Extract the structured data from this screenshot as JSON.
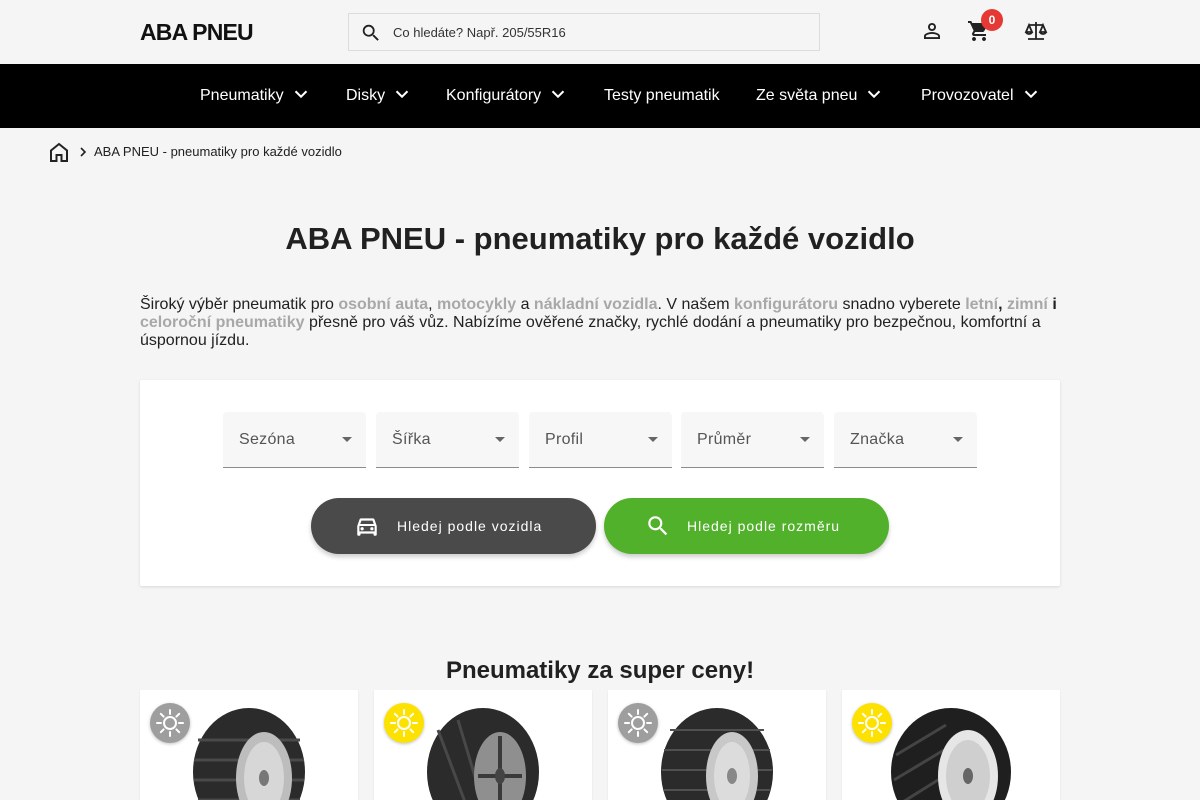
{
  "header": {
    "logo": "ABA PNEU",
    "search_placeholder": "Co hledáte? Např. 205/55R16",
    "cart_count": "0",
    "icons": [
      "account-icon",
      "cart-icon",
      "compare-icon"
    ]
  },
  "nav": {
    "items": [
      {
        "label": "Pneumatiky",
        "has_dropdown": true
      },
      {
        "label": "Disky",
        "has_dropdown": true
      },
      {
        "label": "Konfigurátory",
        "has_dropdown": true
      },
      {
        "label": "Testy pneumatik",
        "has_dropdown": false
      },
      {
        "label": "Ze světa pneu",
        "has_dropdown": true
      },
      {
        "label": "Provozovatel",
        "has_dropdown": true
      }
    ]
  },
  "breadcrumb": {
    "current": "ABA PNEU - pneumatiky pro každé vozidlo"
  },
  "page_title": "ABA PNEU - pneumatiky pro každé vozidlo",
  "intro": {
    "t1": "Široký výběr pneumatik pro ",
    "l1": "osobní auta",
    "t2": ", ",
    "l2": "motocykly",
    "t3": " a ",
    "l3": "nákladní vozidla",
    "t4": ". V našem ",
    "l4": "konfigurátoru",
    "t5": " snadno vyberete ",
    "l5": "letní",
    "t6": ", ",
    "l6": "zimní",
    "t7": " i",
    "l7": "celoroční pneumatiky",
    "t8": " přesně pro váš vůz. Nabízíme ověřené značky, rychlé dodání a pneumatiky pro bezpečnou, komfortní a úspornou jízdu."
  },
  "filters": {
    "selects": [
      "Sezóna",
      "Šířka",
      "Profil",
      "Průměr",
      "Značka"
    ],
    "search_vehicle": "Hledej podle vozidla",
    "search_size": "Hledej podle rozměru"
  },
  "deals": {
    "title": "Pneumatiky za super ceny!",
    "products": [
      {
        "season": "all-season",
        "badge_color": "#9e9e9e"
      },
      {
        "season": "summer",
        "badge_color": "#fde100"
      },
      {
        "season": "all-season",
        "badge_color": "#9e9e9e"
      },
      {
        "season": "summer",
        "badge_color": "#fde100"
      }
    ]
  },
  "colors": {
    "nav_bg": "#000000",
    "accent_green": "#52b12b",
    "button_dark": "#4a4a4a",
    "badge_red": "#e53935",
    "link_gray": "#a8a8a8"
  }
}
